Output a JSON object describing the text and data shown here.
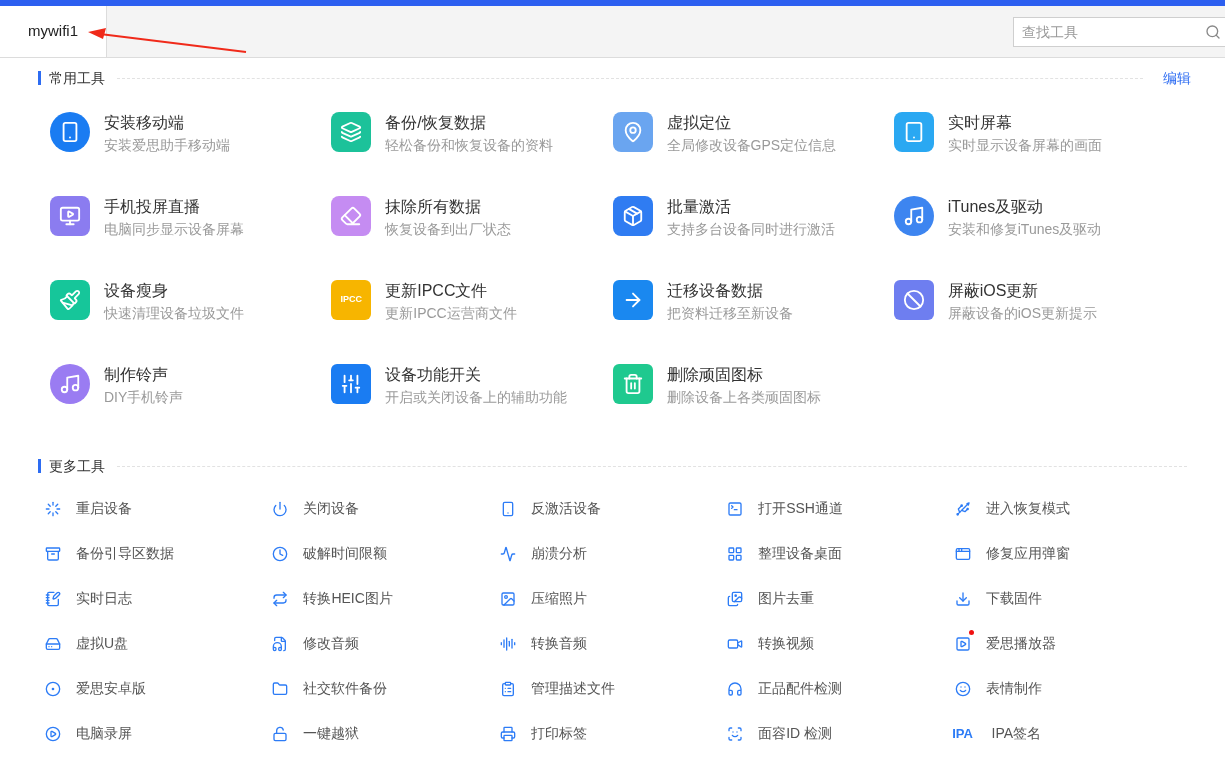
{
  "tabs": [
    {
      "label": "mywifi1",
      "selected": true
    }
  ],
  "search": {
    "placeholder": "查找工具"
  },
  "common_tools": {
    "title": "常用工具",
    "edit_link": "编辑",
    "items": [
      {
        "title": "安装移动端",
        "description": "安装爱思助手移动端"
      },
      {
        "title": "备份/恢复数据",
        "description": "轻松备份和恢复设备的资料"
      },
      {
        "title": "虚拟定位",
        "description": "全局修改设备GPS定位信息"
      },
      {
        "title": "实时屏幕",
        "description": "实时显示设备屏幕的画面"
      },
      {
        "title": "手机投屏直播",
        "description": "电脑同步显示设备屏幕"
      },
      {
        "title": "抹除所有数据",
        "description": "恢复设备到出厂状态"
      },
      {
        "title": "批量激活",
        "description": "支持多台设备同时进行激活"
      },
      {
        "title": "iTunes及驱动",
        "description": "安装和修复iTunes及驱动"
      },
      {
        "title": "设备瘦身",
        "description": "快速清理设备垃圾文件"
      },
      {
        "title": "更新IPCC文件",
        "description": "更新IPCC运营商文件",
        "icon_text": "IPCC"
      },
      {
        "title": "迁移设备数据",
        "description": "把资料迁移至新设备"
      },
      {
        "title": "屏蔽iOS更新",
        "description": "屏蔽设备的iOS更新提示"
      },
      {
        "title": "制作铃声",
        "description": "DIY手机铃声"
      },
      {
        "title": "设备功能开关",
        "description": "开启或关闭设备上的辅助功能"
      },
      {
        "title": "删除顽固图标",
        "description": "删除设备上各类顽固图标"
      }
    ]
  },
  "more_tools": {
    "title": "更多工具",
    "items": [
      {
        "label": "重启设备",
        "new": false
      },
      {
        "label": "关闭设备",
        "new": false
      },
      {
        "label": "反激活设备",
        "new": false
      },
      {
        "label": "打开SSH通道",
        "new": false
      },
      {
        "label": "进入恢复模式",
        "new": false
      },
      {
        "label": "备份引导区数据",
        "new": false
      },
      {
        "label": "破解时间限额",
        "new": false
      },
      {
        "label": "崩溃分析",
        "new": false
      },
      {
        "label": "整理设备桌面",
        "new": false
      },
      {
        "label": "修复应用弹窗",
        "new": false
      },
      {
        "label": "实时日志",
        "new": false
      },
      {
        "label": "转换HEIC图片",
        "new": false
      },
      {
        "label": "压缩照片",
        "new": false
      },
      {
        "label": "图片去重",
        "new": false
      },
      {
        "label": "下载固件",
        "new": false
      },
      {
        "label": "虚拟U盘",
        "new": false
      },
      {
        "label": "修改音频",
        "new": false
      },
      {
        "label": "转换音频",
        "new": false
      },
      {
        "label": "转换视频",
        "new": false
      },
      {
        "label": "爱思播放器",
        "new": true
      },
      {
        "label": "爱思安卓版",
        "new": false
      },
      {
        "label": "社交软件备份",
        "new": false
      },
      {
        "label": "管理描述文件",
        "new": false
      },
      {
        "label": "正品配件检测",
        "new": false
      },
      {
        "label": "表情制作",
        "new": false
      },
      {
        "label": "电脑录屏",
        "new": false
      },
      {
        "label": "一键越狱",
        "new": false
      },
      {
        "label": "打印标签",
        "new": false
      },
      {
        "label": "面容ID 检测",
        "new": false
      },
      {
        "label": "IPA签名",
        "new": false,
        "icon_text": "IPA"
      }
    ]
  }
}
